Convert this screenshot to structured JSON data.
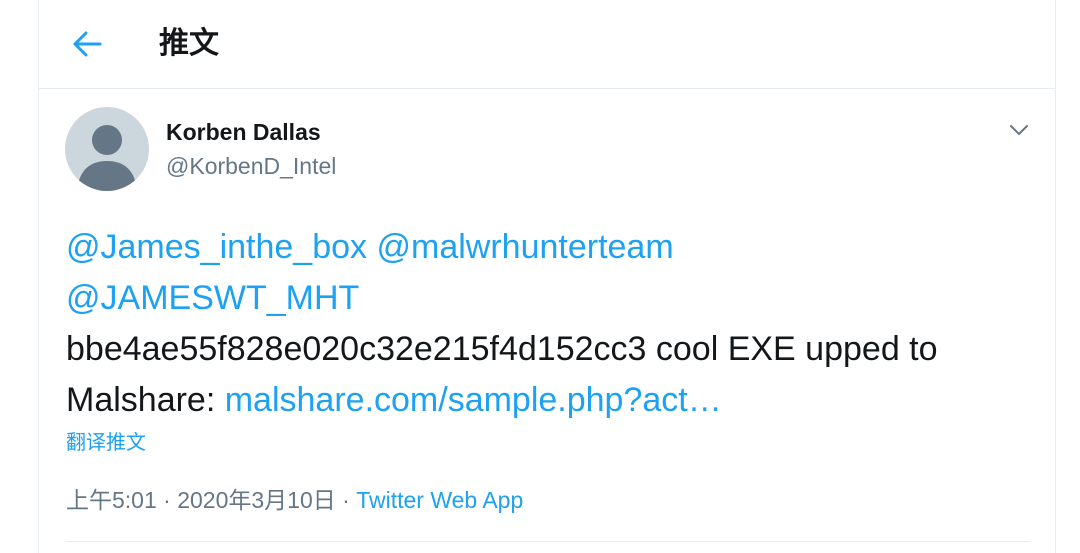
{
  "header": {
    "title": "推文",
    "back_icon": "arrow-left-icon"
  },
  "colors": {
    "accent": "#1da1f2",
    "text": "#14171a",
    "secondary": "#657786",
    "border": "#e6ecf0",
    "avatar_bg": "#ccd6dd",
    "avatar_fg": "#657786"
  },
  "tweet": {
    "author": {
      "name": "Korben Dallas",
      "handle": "@KorbenD_Intel",
      "avatar_icon": "default-profile-icon"
    },
    "menu_icon": "chevron-down-icon",
    "text": {
      "mention_1": "@James_inthe_box",
      "space_1": " ",
      "mention_2": "@malwrhunterteam",
      "mention_3": "@JAMESWT_MHT",
      "body": "bbe4ae55f828e020c32e215f4d152cc3 cool EXE upped to Malshare: ",
      "link": "malshare.com/sample.php?act…"
    },
    "translate_label": "翻译推文",
    "timestamp": "上午5:01 · 2020年3月10日",
    "separator": " · ",
    "source_app": "Twitter Web App"
  }
}
